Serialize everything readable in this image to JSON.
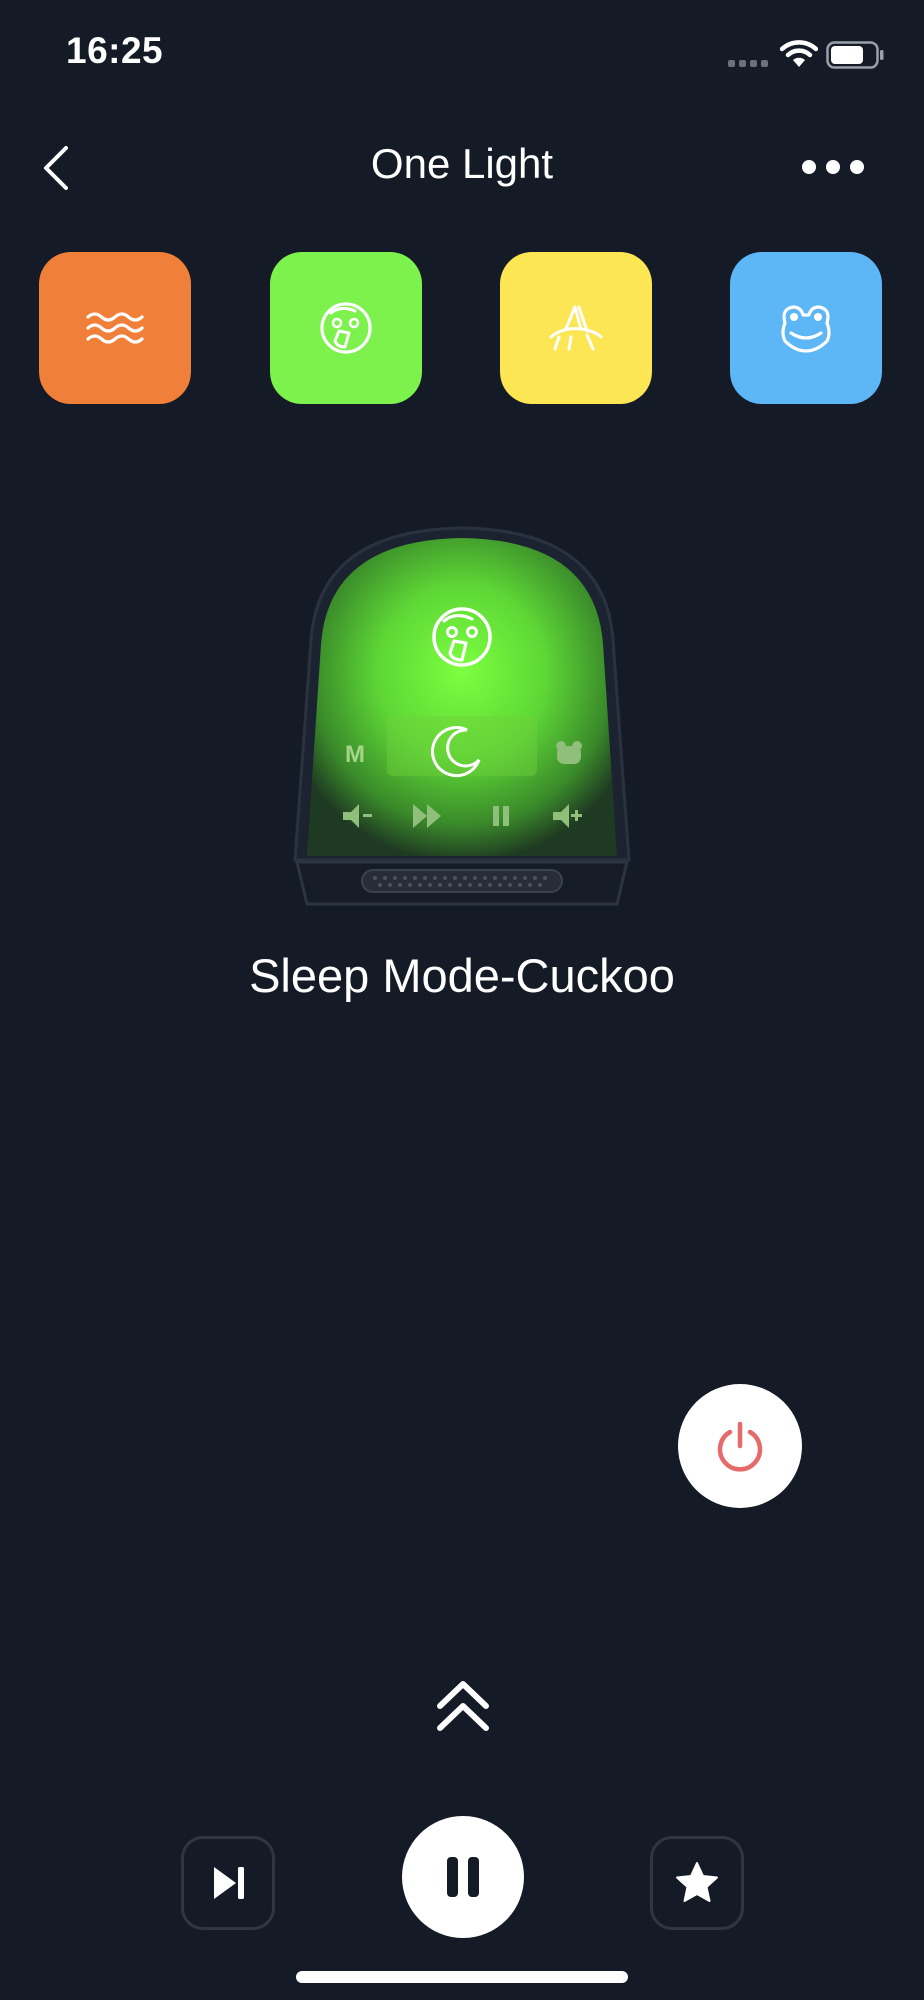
{
  "status_bar": {
    "time": "16:25"
  },
  "header": {
    "title": "One Light"
  },
  "sounds": [
    {
      "name": "waves-icon",
      "color": "#ef7f39"
    },
    {
      "name": "cuckoo-bird-icon",
      "color": "#7ef24c"
    },
    {
      "name": "cricket-icon",
      "color": "#fde654"
    },
    {
      "name": "frog-icon",
      "color": "#5db7f7"
    }
  ],
  "device": {
    "glow_color": "#79ff3c",
    "left_button_label": "M",
    "active_icon": "cuckoo-bird-icon",
    "center_icon": "moon-icon"
  },
  "mode": {
    "label": "Sleep Mode-Cuckoo"
  },
  "colors": {
    "background": "#151b26",
    "power_icon": "#e66a6a"
  }
}
